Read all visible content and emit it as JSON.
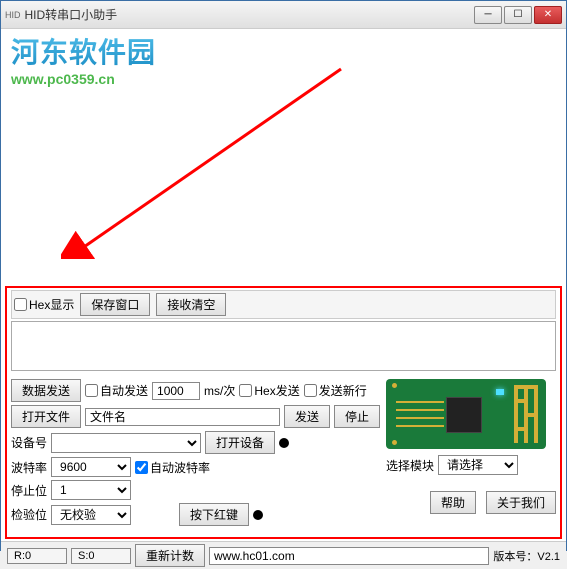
{
  "window": {
    "title": "HID转串口小助手",
    "icon_text": "HID"
  },
  "watermark": {
    "title": "河东软件园",
    "url": "www.pc0359.cn"
  },
  "toolbar": {
    "hex_display": "Hex显示",
    "save_window": "保存窗口",
    "receive_clear": "接收清空"
  },
  "send": {
    "data_send": "数据发送",
    "auto_send": "自动发送",
    "interval": "1000",
    "unit": "ms/次",
    "hex_send": "Hex发送",
    "send_newline": "发送新行"
  },
  "file": {
    "open_file": "打开文件",
    "filename": "文件名",
    "send_btn": "发送",
    "stop_btn": "停止"
  },
  "device": {
    "device_num": "设备号",
    "open_device": "打开设备",
    "baud": "波特率",
    "baud_value": "9600",
    "auto_baud": "自动波特率",
    "stop_bit": "停止位",
    "stop_value": "1",
    "parity": "检验位",
    "parity_value": "无校验",
    "press_red": "按下红键"
  },
  "module": {
    "select_module": "选择模块",
    "please_select": "请选择",
    "help": "帮助",
    "about": "关于我们"
  },
  "status": {
    "r": "R:0",
    "s": "S:0",
    "recount": "重新计数",
    "url": "www.hc01.com",
    "version": "版本号：V2.1"
  }
}
